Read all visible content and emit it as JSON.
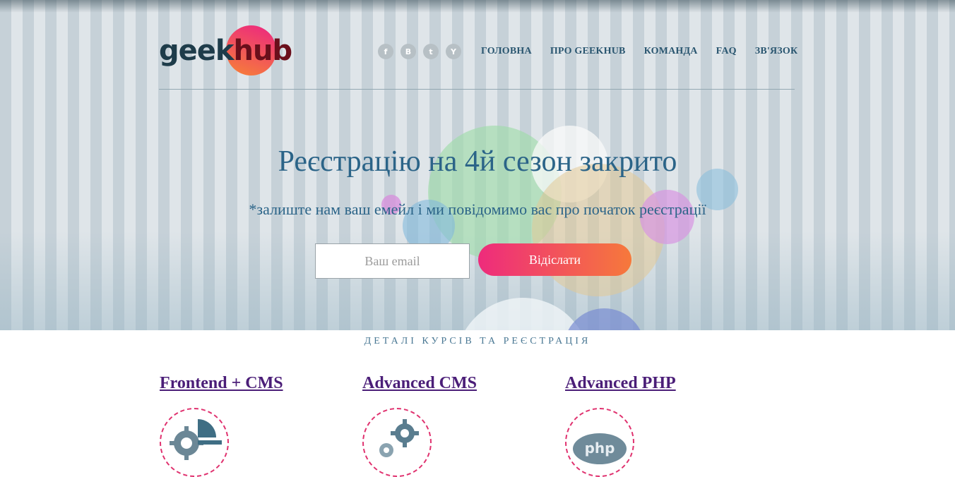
{
  "header": {
    "logo": {
      "part1": "geek",
      "part2": "hub"
    },
    "social": [
      {
        "icon": "facebook-icon",
        "glyph": "f"
      },
      {
        "icon": "vk-icon",
        "glyph": "B"
      },
      {
        "icon": "twitter-icon",
        "glyph": "t"
      },
      {
        "icon": "youtube-icon",
        "glyph": "Y"
      }
    ],
    "nav": [
      "ГОЛОВНА",
      "ПРО GEEKHUB",
      "КОМАНДА",
      "FAQ",
      "ЗВ'ЯЗОК"
    ]
  },
  "hero": {
    "title": "Реєстрацію на 4й сезон закрито",
    "subtitle": "*залиште нам ваш емейл і ми повідомимо вас про початок реєстрації",
    "email_placeholder": "Ваш email",
    "email_value": "",
    "submit_label": "Відіслати"
  },
  "courses": {
    "section_title": "ДЕТАЛІ КУРСІВ ТА РЕЄСТРАЦІЯ",
    "items": [
      {
        "title": "Frontend + CMS",
        "icon": "frontend-cms-icon"
      },
      {
        "title": "Advanced CMS",
        "icon": "gears-icon"
      },
      {
        "title": "Advanced PHP",
        "icon": "php-icon"
      }
    ]
  },
  "colors": {
    "accent_start": "#ee2b7c",
    "accent_end": "#f6793b",
    "heading": "#2b6488",
    "nav": "#2a5670",
    "course_link": "#4b1e78"
  }
}
